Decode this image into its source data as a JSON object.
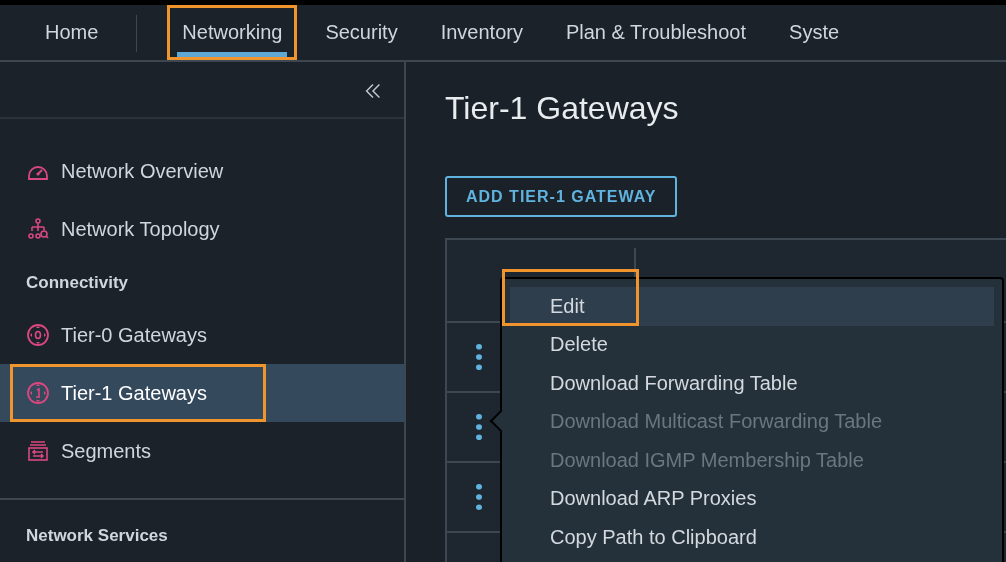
{
  "nav": {
    "tabs": [
      {
        "label": "Home",
        "selected": false,
        "highlighted": false
      },
      {
        "label": "Networking",
        "selected": true,
        "highlighted": true
      },
      {
        "label": "Security",
        "selected": false,
        "highlighted": false
      },
      {
        "label": "Inventory",
        "selected": false,
        "highlighted": false
      },
      {
        "label": "Plan & Troubleshoot",
        "selected": false,
        "highlighted": false
      },
      {
        "label": "Syste",
        "selected": false,
        "highlighted": false
      }
    ]
  },
  "sidebar": {
    "items": [
      {
        "kind": "link",
        "label": "Network Overview",
        "selected": false,
        "highlighted": false
      },
      {
        "kind": "link",
        "label": "Network Topology",
        "selected": false,
        "highlighted": false
      },
      {
        "kind": "heading",
        "label": "Connectivity"
      },
      {
        "kind": "link",
        "label": "Tier-0 Gateways",
        "selected": false,
        "highlighted": false
      },
      {
        "kind": "link",
        "label": "Tier-1 Gateways",
        "selected": true,
        "highlighted": true
      },
      {
        "kind": "link",
        "label": "Segments",
        "selected": false,
        "highlighted": false
      },
      {
        "kind": "divider"
      },
      {
        "kind": "heading",
        "label": "Network Services"
      }
    ]
  },
  "main": {
    "title": "Tier-1 Gateways",
    "add_button": "ADD TIER-1 GATEWAY"
  },
  "context_menu": {
    "items": [
      {
        "label": "Edit",
        "disabled": false,
        "selected": true,
        "highlighted": true
      },
      {
        "label": "Delete",
        "disabled": false,
        "selected": false,
        "highlighted": false
      },
      {
        "label": "Download Forwarding Table",
        "disabled": false,
        "selected": false,
        "highlighted": false
      },
      {
        "label": "Download Multicast Forwarding Table",
        "disabled": true,
        "selected": false,
        "highlighted": false
      },
      {
        "label": "Download IGMP Membership Table",
        "disabled": true,
        "selected": false,
        "highlighted": false
      },
      {
        "label": "Download ARP Proxies",
        "disabled": false,
        "selected": false,
        "highlighted": false
      },
      {
        "label": "Copy Path to Clipboard",
        "disabled": false,
        "selected": false,
        "highlighted": false
      }
    ]
  }
}
